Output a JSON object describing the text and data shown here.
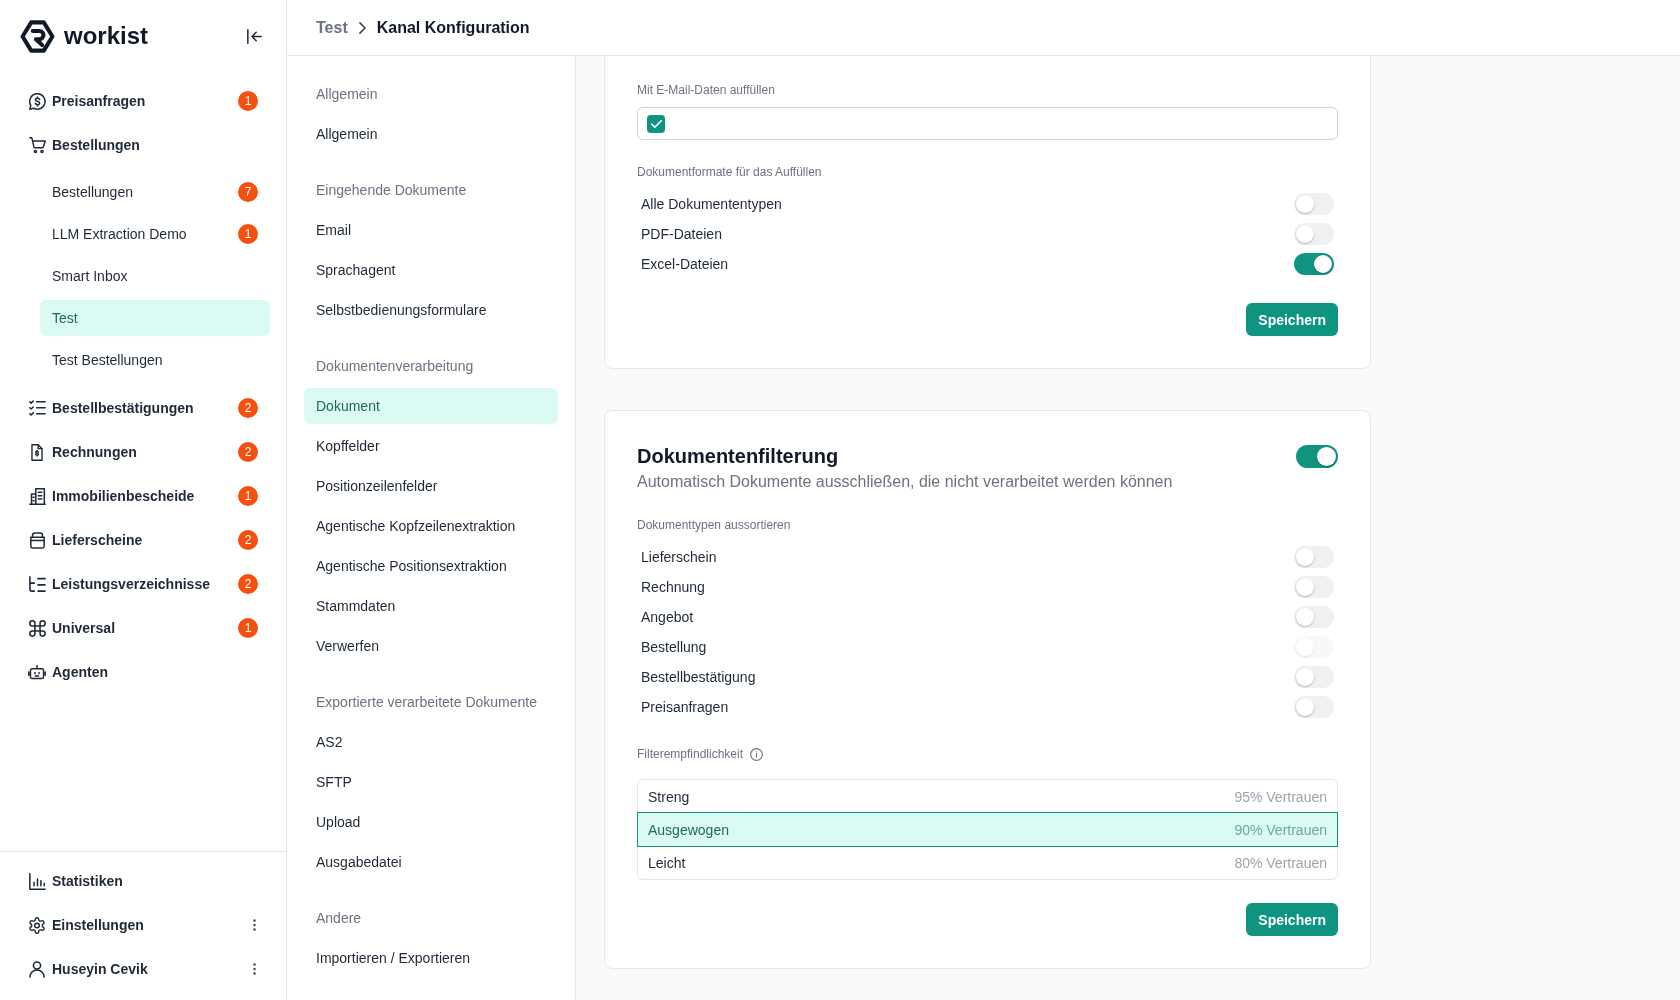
{
  "sidebar": {
    "logo": {
      "wordmark": "workist"
    },
    "items": [
      {
        "label": "Preisanfragen",
        "badge": "1",
        "selected": false
      },
      {
        "label": "Bestellungen",
        "selected": false,
        "children": [
          {
            "label": "Bestellungen",
            "badge": "7",
            "selected": false
          },
          {
            "label": "LLM Extraction Demo",
            "badge": "1",
            "selected": false
          },
          {
            "label": "Smart Inbox",
            "selected": false
          },
          {
            "label": "Test",
            "selected": true
          },
          {
            "label": "Test Bestellungen",
            "selected": false
          }
        ]
      },
      {
        "label": "Bestellbestätigungen",
        "badge": "2",
        "selected": false
      },
      {
        "label": "Rechnungen",
        "badge": "2",
        "selected": false
      },
      {
        "label": "Immobilienbescheide",
        "badge": "1",
        "selected": false
      },
      {
        "label": "Lieferscheine",
        "badge": "2",
        "selected": false
      },
      {
        "label": "Leistungsverzeichnisse",
        "badge": "2",
        "selected": false
      },
      {
        "label": "Universal",
        "badge": "1",
        "selected": false
      },
      {
        "label": "Agenten",
        "selected": false
      }
    ],
    "footer_items": [
      {
        "label": "Statistiken",
        "kind": "link"
      },
      {
        "label": "Einstellungen",
        "kind": "menu"
      },
      {
        "label": "Huseyin Cevik",
        "kind": "menu"
      }
    ]
  },
  "breadcrumb": [
    "Test",
    "Kanal Konfiguration"
  ],
  "settings_nav": {
    "sections": [
      {
        "heading": "Allgemein",
        "items": [
          {
            "label": "Allgemein",
            "selected": false
          }
        ]
      },
      {
        "heading": "Eingehende Dokumente",
        "items": [
          {
            "label": "Email",
            "selected": false
          },
          {
            "label": "Sprachagent",
            "selected": false
          },
          {
            "label": "Selbstbedienungsformulare",
            "selected": false
          }
        ]
      },
      {
        "heading": "Dokumentenverarbeitung",
        "items": [
          {
            "label": "Dokument",
            "selected": true
          },
          {
            "label": "Kopffelder",
            "selected": false
          },
          {
            "label": "Positionzeilenfelder",
            "selected": false
          },
          {
            "label": "Agentische Kopfzeilenextraktion",
            "selected": false
          },
          {
            "label": "Agentische Positionsextraktion",
            "selected": false
          },
          {
            "label": "Stammdaten",
            "selected": false
          },
          {
            "label": "Verwerfen",
            "selected": false
          }
        ]
      },
      {
        "heading": "Exportierte verarbeitete Dokumente",
        "items": [
          {
            "label": "AS2",
            "selected": false
          },
          {
            "label": "SFTP",
            "selected": false
          },
          {
            "label": "Upload",
            "selected": false
          },
          {
            "label": "Ausgabedatei",
            "selected": false
          }
        ]
      },
      {
        "heading": "Andere",
        "items": [
          {
            "label": "Importieren / Exportieren",
            "selected": false
          }
        ]
      }
    ]
  },
  "email_card": {
    "fill_label": "Mit E-Mail-Daten auffüllen",
    "fill_checked": true,
    "formats_label": "Dokumentformate für das Auffüllen",
    "formats": [
      {
        "label": "Alle Dokumententypen",
        "on": false
      },
      {
        "label": "PDF-Dateien",
        "on": false
      },
      {
        "label": "Excel-Dateien",
        "on": true
      }
    ],
    "save_button": "Speichern"
  },
  "filter_card": {
    "title": "Dokumentenfilterung",
    "on": true,
    "subtitle": "Automatisch Dokumente ausschließen, die nicht verarbeitet werden können",
    "types_label": "Dokumenttypen aussortieren",
    "types": [
      {
        "label": "Lieferschein",
        "on": false,
        "disabled": false
      },
      {
        "label": "Rechnung",
        "on": false,
        "disabled": false
      },
      {
        "label": "Angebot",
        "on": false,
        "disabled": false
      },
      {
        "label": "Bestellung",
        "on": false,
        "disabled": true
      },
      {
        "label": "Bestellbestätigung",
        "on": false,
        "disabled": false
      },
      {
        "label": "Preisanfragen",
        "on": false,
        "disabled": false
      }
    ],
    "sensitivity_label": "Filterempfindlichkeit",
    "sensitivity": [
      {
        "label": "Streng",
        "confidence": "95% Vertrauen",
        "selected": false
      },
      {
        "label": "Ausgewogen",
        "confidence": "90% Vertrauen",
        "selected": true
      },
      {
        "label": "Leicht",
        "confidence": "80% Vertrauen",
        "selected": false
      }
    ],
    "save_button": "Speichern"
  }
}
